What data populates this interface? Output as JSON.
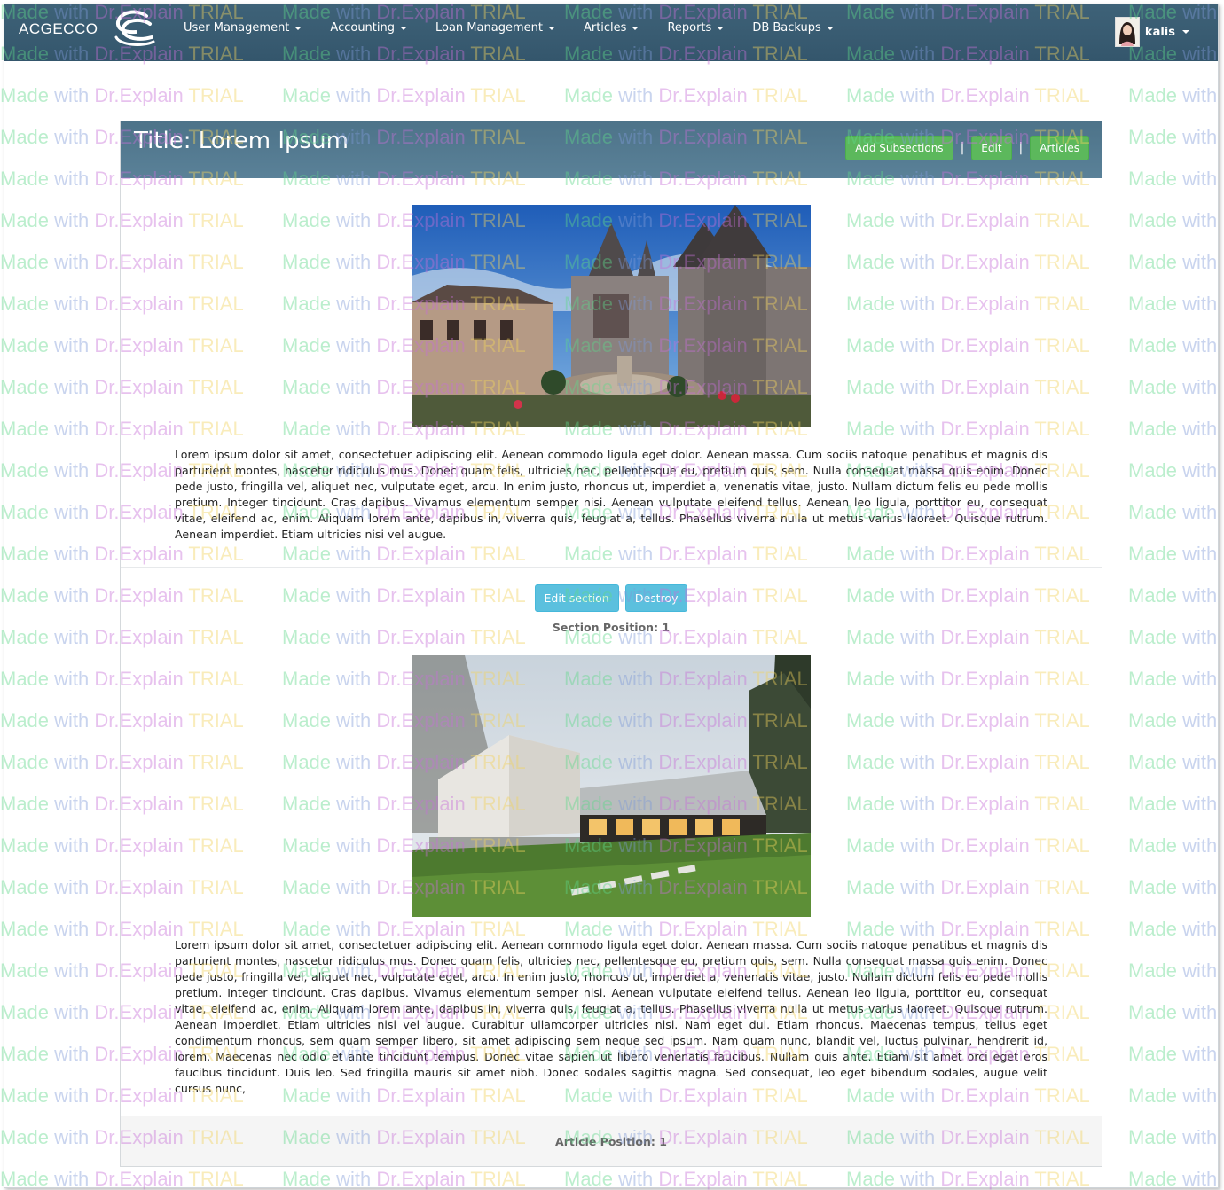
{
  "navbar": {
    "brand": "ACGECCO",
    "items": [
      {
        "label": "User Management"
      },
      {
        "label": "Accounting"
      },
      {
        "label": "Loan Management"
      },
      {
        "label": "Articles"
      },
      {
        "label": "Reports"
      },
      {
        "label": "DB Backups"
      }
    ],
    "user": "kalis"
  },
  "article": {
    "title": "Title: Lorem Ipsum",
    "actions": {
      "add_subsections": "Add Subsections",
      "separator": "|",
      "edit": "Edit",
      "articles": "Articles"
    },
    "sections": [
      {
        "image": "castle-village-photo",
        "text": "Lorem ipsum dolor sit amet, consectetuer adipiscing elit. Aenean commodo ligula eget dolor. Aenean massa. Cum sociis natoque penatibus et magnis dis parturient montes, nascetur ridiculus mus. Donec quam felis, ultricies nec, pellentesque eu, pretium quis, sem. Nulla consequat massa quis enim. Donec pede justo, fringilla vel, aliquet nec, vulputate eget, arcu. In enim justo, rhoncus ut, imperdiet a, venenatis vitae, justo. Nullam dictum felis eu pede mollis pretium. Integer tincidunt. Cras dapibus. Vivamus elementum semper nisi. Aenean vulputate eleifend tellus. Aenean leo ligula, porttitor eu, consequat vitae, eleifend ac, enim. Aliquam lorem ante, dapibus in, viverra quis, feugiat a, tellus. Phasellus viverra nulla ut metus varius laoreet. Quisque rutrum. Aenean imperdiet. Etiam ultricies nisi vel augue.",
        "edit_label": "Edit section",
        "destroy_label": "Destroy",
        "position_label": "Section Position: 1"
      },
      {
        "image": "modern-building-photo",
        "text": "Lorem ipsum dolor sit amet, consectetuer adipiscing elit. Aenean commodo ligula eget dolor. Aenean massa. Cum sociis natoque penatibus et magnis dis parturient montes, nascetur ridiculus mus. Donec quam felis, ultricies nec, pellentesque eu, pretium quis, sem. Nulla consequat massa quis enim. Donec pede justo, fringilla vel, aliquet nec, vulputate eget, arcu. In enim justo, rhoncus ut, imperdiet a, venenatis vitae, justo. Nullam dictum felis eu pede mollis pretium. Integer tincidunt. Cras dapibus. Vivamus elementum semper nisi. Aenean vulputate eleifend tellus. Aenean leo ligula, porttitor eu, consequat vitae, eleifend ac, enim. Aliquam lorem ante, dapibus in, viverra quis, feugiat a, tellus. Phasellus viverra nulla ut metus varius laoreet. Quisque rutrum. Aenean imperdiet. Etiam ultricies nisi vel augue. Curabitur ullamcorper ultricies nisi. Nam eget dui. Etiam rhoncus. Maecenas tempus, tellus eget condimentum rhoncus, sem quam semper libero, sit amet adipiscing sem neque sed ipsum. Nam quam nunc, blandit vel, luctus pulvinar, hendrerit id, lorem. Maecenas nec odio et ante tincidunt tempus. Donec vitae sapien ut libero venenatis faucibus. Nullam quis ante. Etiam sit amet orci eget eros faucibus tincidunt. Duis leo. Sed fringilla mauris sit amet nibh. Donec sodales sagittis magna. Sed consequat, leo eget bibendum sodales, augue velit cursus nunc,"
      }
    ],
    "footer_position": "Article Position: 1"
  },
  "watermark": {
    "made": "Made",
    "with": " with ",
    "dr": "Dr.Explain",
    "trial": " TRIAL"
  },
  "colors": {
    "navbar": "#3a5d73",
    "panel_header": "#52798f",
    "success": "#5cb85c",
    "info": "#5bc0de"
  }
}
